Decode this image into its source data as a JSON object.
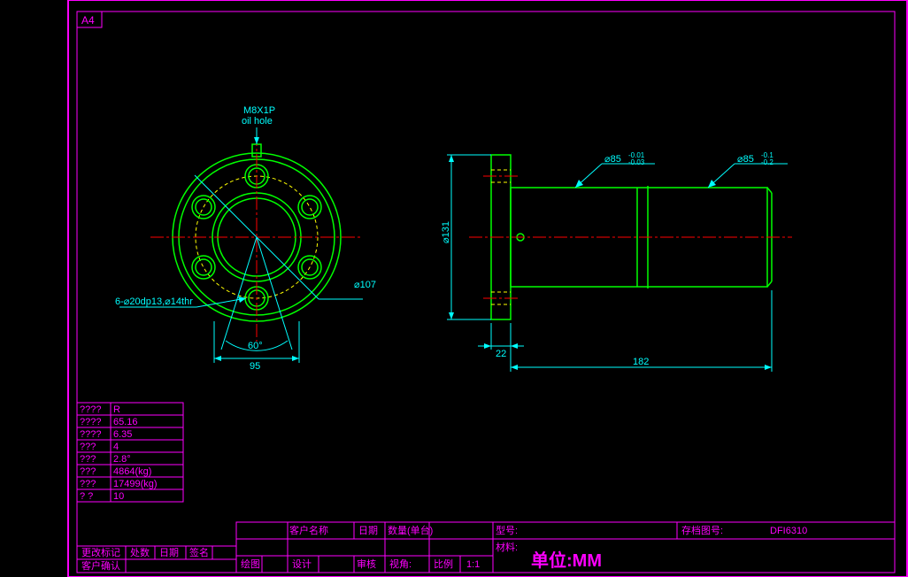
{
  "sheet": "A4",
  "annotations": {
    "top_note1": "M8X1P",
    "top_note2": "oil hole",
    "hole_spec": "6-⌀20dp13,⌀14thr",
    "dim_angle": "60°",
    "dim_95": "95",
    "dim_107": "⌀107",
    "dim_131": "⌀131",
    "dim_22": "22",
    "dim_182": "182",
    "dim_85a": "⌀85",
    "tol_85a_up": "-0.01",
    "tol_85a_low": "-0.03",
    "dim_85b": "⌀85",
    "tol_85b_up": "-0.1",
    "tol_85b_low": "-0.2"
  },
  "data_table": [
    {
      "k": "????",
      "v": "R"
    },
    {
      "k": "????",
      "v": "65.16"
    },
    {
      "k": "????",
      "v": "6.35"
    },
    {
      "k": "???",
      "v": " 4"
    },
    {
      "k": "???",
      "v": " 2.8°"
    },
    {
      "k": "???",
      "v": " 4864(kg)"
    },
    {
      "k": "???",
      "v": " 17499(kg)"
    },
    {
      "k": "?  ?",
      "v": " 10"
    }
  ],
  "title_block": {
    "row1": {
      "customer": "客户名称",
      "date": "日期",
      "qty": "数量(单台)",
      "model": "型号:",
      "drawing_no_label": "存档图号:",
      "drawing_no": "DFI6310"
    },
    "row2_material": "材料:",
    "row3": {
      "draw": "绘图",
      "design": "设计",
      "check": "审核",
      "view": "视角:",
      "scale": "比例",
      "scale_val": "1:1"
    },
    "units": "单位:MM",
    "change_mark": "更改标记",
    "count": "处数",
    "date2": "日期",
    "sign": "签名",
    "customer_confirm": "客户确认"
  }
}
